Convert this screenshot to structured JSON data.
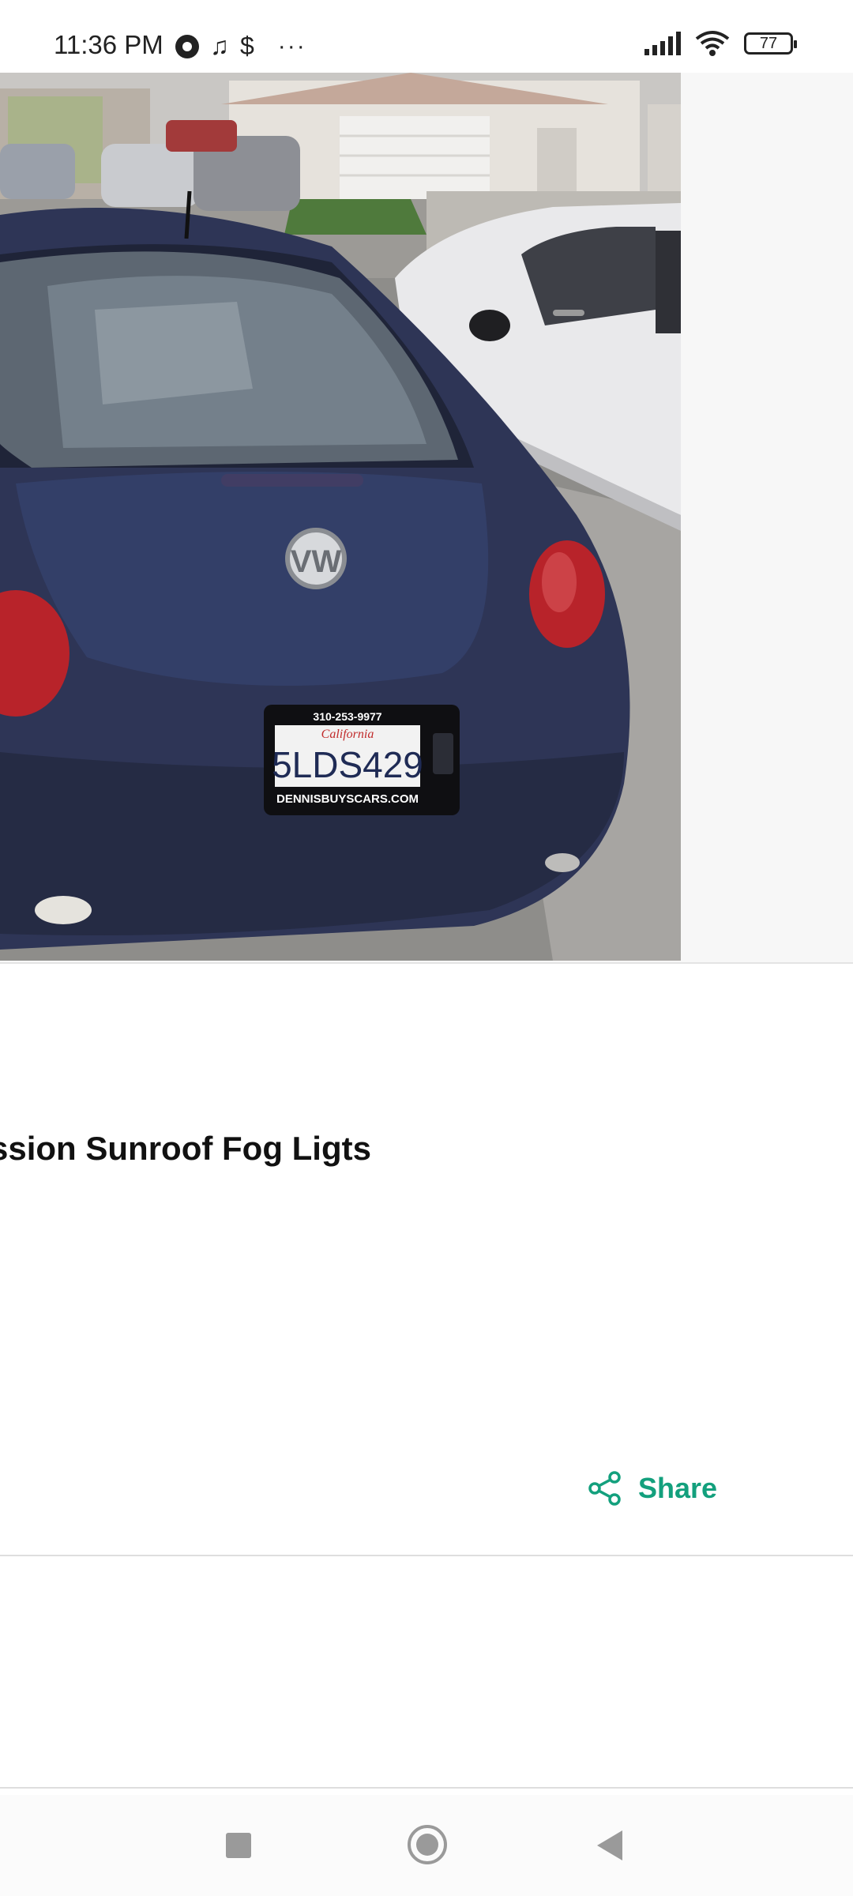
{
  "status_bar": {
    "time": "11:36 PM",
    "extra_icons": [
      "chrome-icon",
      "music-note-icon",
      "dollar-icon"
    ],
    "music_glyph": "♫",
    "dollar_glyph": "$",
    "more": "···",
    "battery": "77"
  },
  "listing": {
    "photo": {
      "subject": "car-photo",
      "plate_frame_top": "310-253-9977",
      "plate_state": "California",
      "plate_number": "5LDS429",
      "plate_frame_bottom": "DENNISBUYSCARS.COM"
    },
    "title": "mission Sunroof Fog Ligts",
    "share_label": "Share"
  },
  "colors": {
    "accent": "#13a07d",
    "car_body": "#2e3556",
    "taillight": "#b8232a"
  }
}
